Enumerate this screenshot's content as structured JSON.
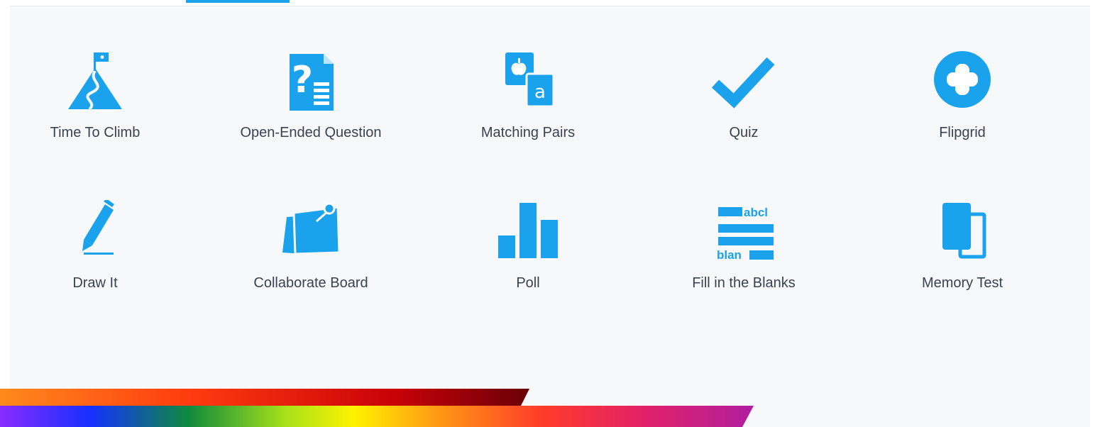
{
  "brand": {
    "accent": "#1aa3ec",
    "label_color": "#3b4151"
  },
  "activities": [
    {
      "label": "Time To Climb",
      "icon": "mountain-flag-icon"
    },
    {
      "label": "Open-Ended Question",
      "icon": "question-document-icon"
    },
    {
      "label": "Matching Pairs",
      "icon": "matching-cards-icon"
    },
    {
      "label": "Quiz",
      "icon": "checkmark-icon"
    },
    {
      "label": "Flipgrid",
      "icon": "plus-circle-icon"
    },
    {
      "label": "Draw It",
      "icon": "pencil-icon"
    },
    {
      "label": "Collaborate Board",
      "icon": "sticky-note-icon"
    },
    {
      "label": "Poll",
      "icon": "bar-chart-icon"
    },
    {
      "label": "Fill in the Blanks",
      "icon": "fill-blanks-icon",
      "icon_text": [
        "abcl",
        "blan"
      ]
    },
    {
      "label": "Memory Test",
      "icon": "memory-cards-icon"
    }
  ]
}
